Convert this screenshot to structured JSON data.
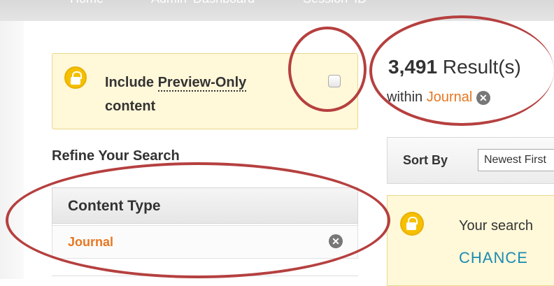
{
  "top_nav": {
    "items": [
      "Home",
      "Admin Dashboard",
      "Session ID"
    ]
  },
  "preview": {
    "label_before": "Include ",
    "label_link": "Preview-Only",
    "label_after": "content",
    "checked": false
  },
  "results": {
    "count": "3,491",
    "suffix": " Result(s)",
    "within_prefix": "within ",
    "within_filter": "Journal"
  },
  "refine": {
    "title": "Refine Your Search",
    "facet_title": "Content Type",
    "facet_value": "Journal"
  },
  "sort": {
    "label": "Sort By",
    "selected": "Newest First"
  },
  "notice": {
    "text": "Your search",
    "link": "CHANCE"
  },
  "colors": {
    "annotation": "#b5403f",
    "accent_orange": "#e87722",
    "link_blue": "#1a8bb3",
    "preview_bg": "#fff8d9"
  }
}
